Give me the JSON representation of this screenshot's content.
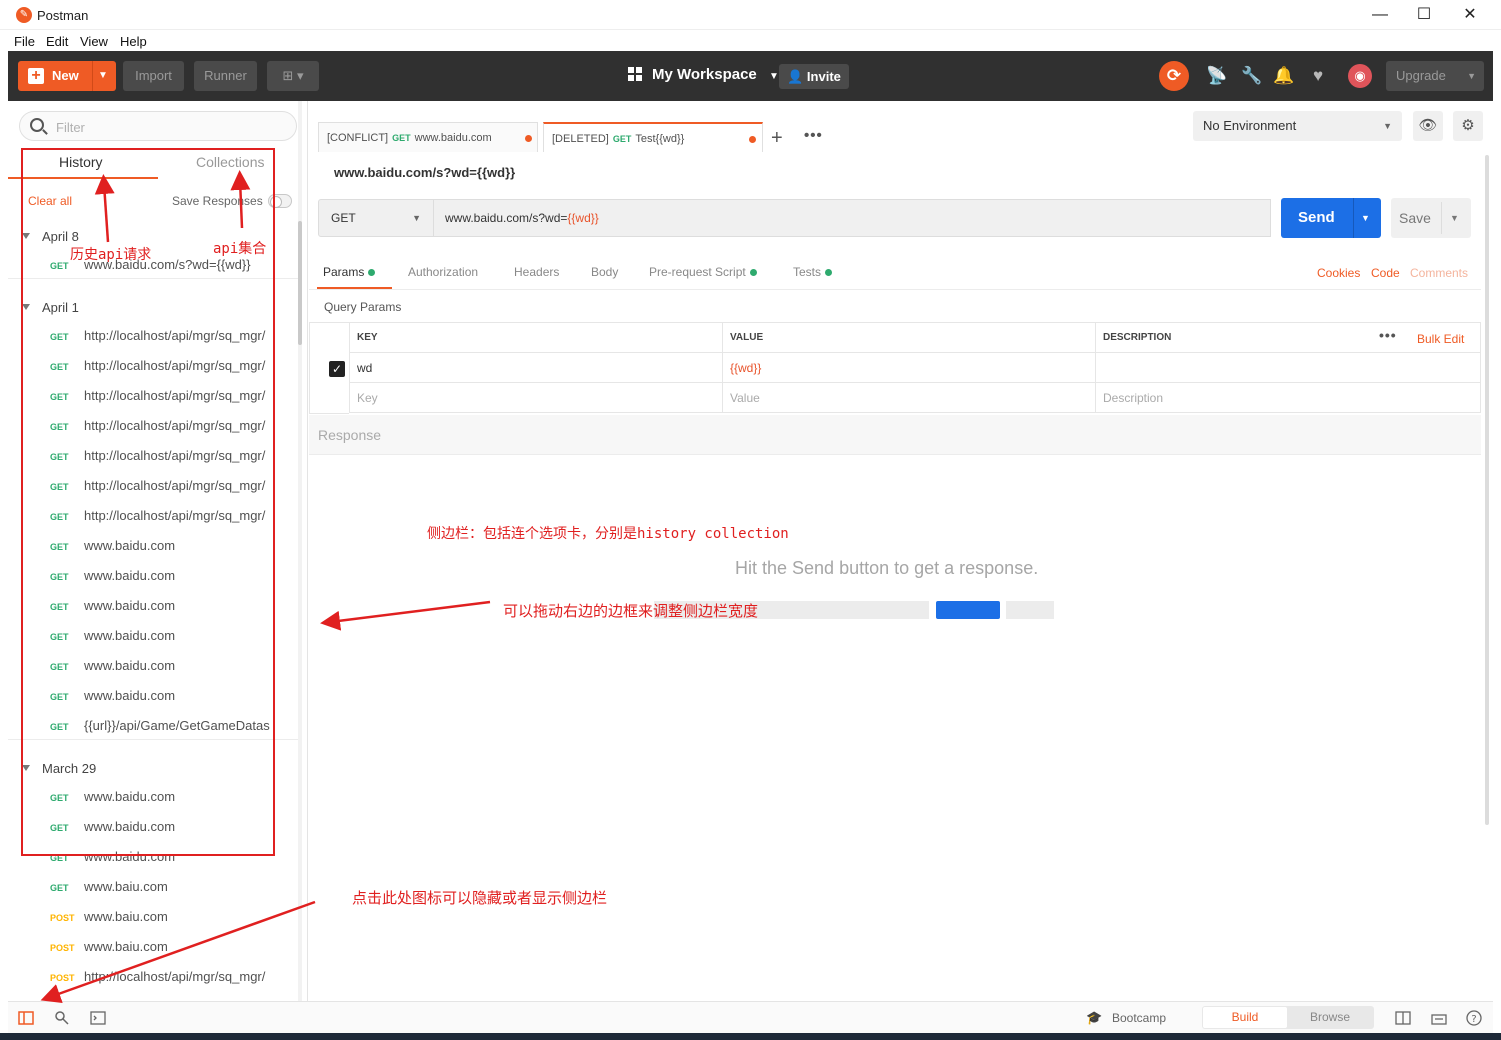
{
  "window": {
    "title": "Postman",
    "minimize": "—",
    "maximize": "☐",
    "close": "✕"
  },
  "menu": [
    "File",
    "Edit",
    "View",
    "Help"
  ],
  "header": {
    "new_label": "New",
    "import_label": "Import",
    "runner_label": "Runner",
    "workspace_label": "My Workspace",
    "invite_label": "Invite",
    "upgrade_label": "Upgrade"
  },
  "sidebar": {
    "filter_placeholder": "Filter",
    "tabs": [
      "History",
      "Collections"
    ],
    "clear_all": "Clear all",
    "save_responses": "Save Responses",
    "groups": [
      {
        "date": "April 8",
        "items": [
          {
            "method": "GET",
            "url": "www.baidu.com/s?wd={{wd}}"
          }
        ]
      },
      {
        "date": "April 1",
        "items": [
          {
            "method": "GET",
            "url": "http://localhost/api/mgr/sq_mgr/"
          },
          {
            "method": "GET",
            "url": "http://localhost/api/mgr/sq_mgr/"
          },
          {
            "method": "GET",
            "url": "http://localhost/api/mgr/sq_mgr/"
          },
          {
            "method": "GET",
            "url": "http://localhost/api/mgr/sq_mgr/"
          },
          {
            "method": "GET",
            "url": "http://localhost/api/mgr/sq_mgr/"
          },
          {
            "method": "GET",
            "url": "http://localhost/api/mgr/sq_mgr/"
          },
          {
            "method": "GET",
            "url": "http://localhost/api/mgr/sq_mgr/"
          },
          {
            "method": "GET",
            "url": "www.baidu.com"
          },
          {
            "method": "GET",
            "url": "www.baidu.com"
          },
          {
            "method": "GET",
            "url": "www.baidu.com"
          },
          {
            "method": "GET",
            "url": "www.baidu.com"
          },
          {
            "method": "GET",
            "url": "www.baidu.com"
          },
          {
            "method": "GET",
            "url": "www.baidu.com"
          },
          {
            "method": "GET",
            "url": "{{url}}/api/Game/GetGameDatas"
          }
        ]
      },
      {
        "date": "March 29",
        "items": [
          {
            "method": "GET",
            "url": "www.baidu.com"
          },
          {
            "method": "GET",
            "url": "www.baidu.com"
          },
          {
            "method": "GET",
            "url": "www.baidu.com"
          },
          {
            "method": "GET",
            "url": "www.baiu.com"
          },
          {
            "method": "POST",
            "url": "www.baiu.com"
          },
          {
            "method": "POST",
            "url": "www.baiu.com"
          },
          {
            "method": "POST",
            "url": "http://localhost/api/mgr/sq_mgr/"
          }
        ]
      }
    ]
  },
  "tabs": [
    {
      "prefix": "[CONFLICT]",
      "method": "GET",
      "name": "www.baidu.com"
    },
    {
      "prefix": "[DELETED]",
      "method": "GET",
      "name": "Test{{wd}}"
    }
  ],
  "environment": "No Environment",
  "request": {
    "name": "www.baidu.com/s?wd={{wd}}",
    "method": "GET",
    "url_base": "www.baidu.com/s?wd=",
    "url_var": "{{wd}}",
    "send_label": "Send",
    "save_label": "Save"
  },
  "request_tabs": [
    "Params",
    "Authorization",
    "Headers",
    "Body",
    "Pre-request Script",
    "Tests"
  ],
  "request_links": [
    "Cookies",
    "Code",
    "Comments"
  ],
  "params": {
    "title": "Query Params",
    "headers": [
      "KEY",
      "VALUE",
      "DESCRIPTION"
    ],
    "bulk_edit": "Bulk Edit",
    "row": {
      "key": "wd",
      "value": "{{wd}}"
    },
    "placeholders": {
      "key": "Key",
      "value": "Value",
      "description": "Description"
    }
  },
  "response": {
    "title": "Response",
    "hint": "Hit the Send button to get a response."
  },
  "footer": {
    "bootcamp": "Bootcamp",
    "build": "Build",
    "browse": "Browse"
  },
  "annotations": {
    "history": "历史api请求",
    "collections": "api集合",
    "sidebar_desc": "侧边栏：包括连个选项卡，分别是history collection",
    "drag": "可以拖动右边的边框来调整侧边栏宽度",
    "toggle": "点击此处图标可以隐藏或者显示侧边栏"
  },
  "colors": {
    "accent": "#ef5b25",
    "send": "#1c6fe6",
    "get": "#2eaa6e",
    "post": "#ffb400",
    "annotation": "#e02020"
  }
}
